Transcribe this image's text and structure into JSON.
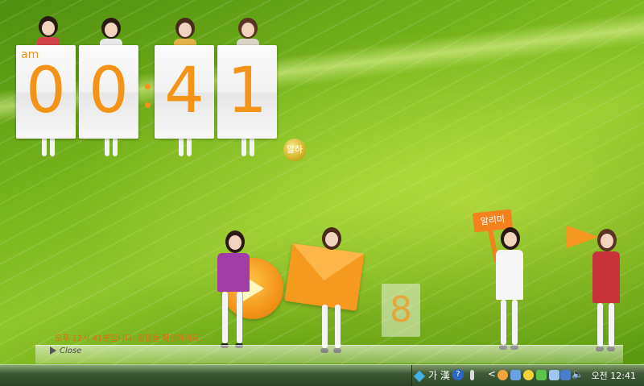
{
  "clock": {
    "ampm": "am",
    "digits": [
      "0",
      "0",
      "4",
      "1"
    ]
  },
  "badge": {
    "label": "알하"
  },
  "widgets": {
    "notice": "오후 12시 41분입니다. 알림을 확인하세요.",
    "close_label": "Close",
    "counter_value": "8",
    "sign_label": "알리미"
  },
  "taskbar": {
    "ime_label": "가 漢",
    "help_label": "?",
    "overflow_label": "<",
    "time": "오전 12:41"
  },
  "colors": {
    "accent": "#f39419",
    "leaf": "#78b51c",
    "taskbar": "#3d5a34"
  }
}
